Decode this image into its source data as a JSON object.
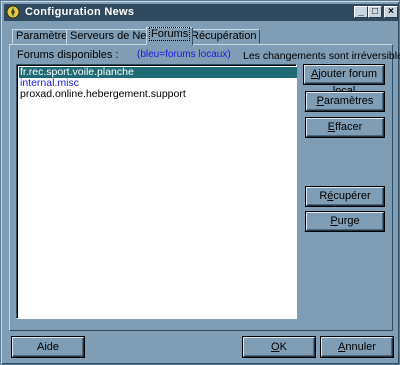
{
  "window": {
    "title": "Configuration News",
    "controls": {
      "minimize": "_",
      "maximize": "□",
      "close": "×"
    }
  },
  "tabs": [
    {
      "label": "Paramètres"
    },
    {
      "label": "Serveurs de News"
    },
    {
      "label": "Forums"
    },
    {
      "label": "Récupération"
    }
  ],
  "forums": {
    "available_label": "Forums disponibles :",
    "legend": "(bleu=forums locaux)",
    "warning": "Les changements sont irréversibles !",
    "list": [
      {
        "name": "fr.rec.sport.voile.planche",
        "selected": true,
        "local": false
      },
      {
        "name": "internal.misc",
        "selected": false,
        "local": true
      },
      {
        "name": "proxad.online.hebergement.support",
        "selected": false,
        "local": false
      }
    ]
  },
  "side_buttons": {
    "add_local": {
      "access": "A",
      "rest": "jouter forum local"
    },
    "params": {
      "access": "P",
      "rest": "aramètres"
    },
    "delete": {
      "access": "E",
      "rest": "ffacer"
    },
    "recover": {
      "pre": "R",
      "access": "é",
      "rest": "cupérer"
    },
    "purge": {
      "access": "P",
      "rest": "urge"
    }
  },
  "footer": {
    "help": "Aide",
    "ok": {
      "access": "O",
      "rest": "K"
    },
    "cancel": {
      "access": "A",
      "rest": "nnuler"
    }
  },
  "colors": {
    "window_bg": "#7f9db5",
    "titlebar": "#2f4a5e",
    "selection": "#1e6b75",
    "local_forum": "#1a1ae0",
    "legend": "#1a1ae0"
  },
  "icons": {
    "app": "ship-wheel-icon"
  }
}
